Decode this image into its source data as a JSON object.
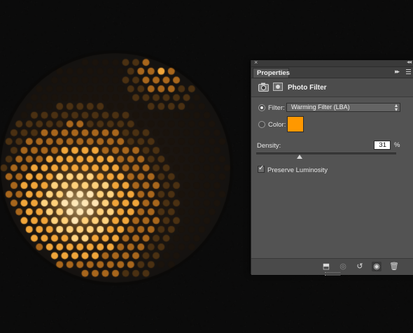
{
  "panel": {
    "tab_label": "Properties",
    "title": "Photo Filter",
    "icons": {
      "close": "close-icon",
      "collapse": "collapse-icon",
      "expand": "double-arrow-icon",
      "menu": "panel-menu-icon",
      "adjustment": "camera-adjustment-icon",
      "mask": "layer-mask-icon"
    },
    "filter": {
      "label": "Filter:",
      "selected": true,
      "value": "Warming Filter (LBA)"
    },
    "color": {
      "label": "Color:",
      "selected": false,
      "swatch": "#ff9800"
    },
    "density": {
      "label": "Density:",
      "value": "31",
      "unit": "%",
      "level": 0.31
    },
    "preserve_luminosity": {
      "label": "Preserve Luminosity",
      "checked": true
    },
    "footer_icons": [
      "clip-to-layer-icon",
      "view-previous-state-icon",
      "reset-icon",
      "visibility-eye-icon",
      "trash-icon"
    ]
  },
  "colors": {
    "panel_bg": "#535353",
    "accent_orange": "#ff9800",
    "canvas_bg": "#0b0b0b",
    "glow": "#ffb347"
  }
}
